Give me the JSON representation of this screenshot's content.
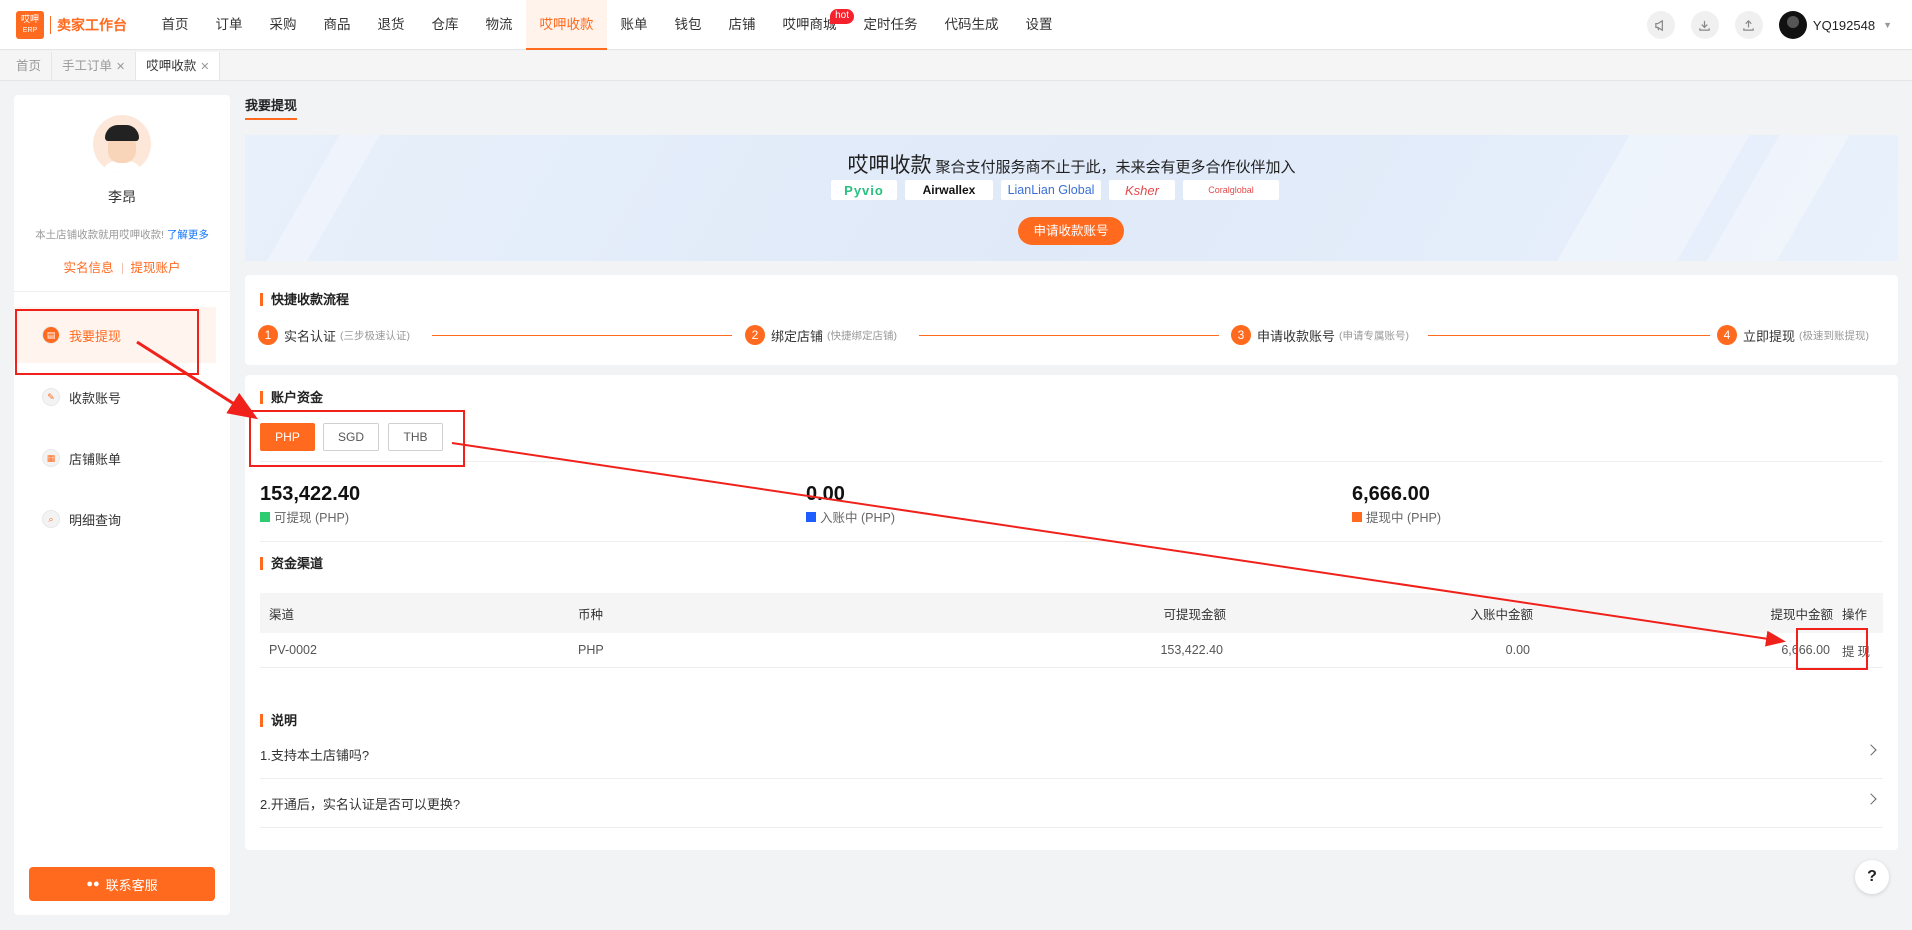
{
  "app": {
    "logo_small": "哎呷",
    "logo_tag": "ERP",
    "logo_text": "卖家工作台"
  },
  "nav": {
    "items": [
      "首页",
      "订单",
      "采购",
      "商品",
      "退货",
      "仓库",
      "物流",
      "哎呷收款",
      "账单",
      "钱包",
      "店铺",
      "哎呷商城",
      "定时任务",
      "代码生成",
      "设置"
    ],
    "active_index": 7,
    "hot_badge": "hot",
    "user": "YQ192548"
  },
  "tabs": [
    {
      "label": "首页",
      "closable": false
    },
    {
      "label": "手工订单",
      "closable": true
    },
    {
      "label": "哎呷收款",
      "closable": true
    }
  ],
  "profile": {
    "name": "李昂",
    "desc": "本土店铺收款就用哎呷收款!",
    "learn_more": "了解更多",
    "link_realname": "实名信息",
    "link_account": "提现账户"
  },
  "menu": [
    {
      "label": "我要提现",
      "active": true
    },
    {
      "label": "收款账号",
      "active": false
    },
    {
      "label": "店铺账单",
      "active": false
    },
    {
      "label": "明细查询",
      "active": false
    }
  ],
  "contact_label": "联系客服",
  "page_tab": "我要提现",
  "banner": {
    "title_big": "哎呷收款",
    "title_small": "聚合支付服务商不止于此，未来会有更多合作伙伴加入",
    "partners": [
      "Pyvio",
      "Airwallex",
      "LianLian Global",
      "Ksher",
      "Coralglobal"
    ],
    "apply_label": "申请收款账号"
  },
  "flow": {
    "title": "快捷收款流程",
    "steps": [
      {
        "num": "1",
        "label": "实名认证",
        "sub": "(三步极速认证)"
      },
      {
        "num": "2",
        "label": "绑定店铺",
        "sub": "(快捷绑定店铺)"
      },
      {
        "num": "3",
        "label": "申请收款账号",
        "sub": "(申请专属账号)"
      },
      {
        "num": "4",
        "label": "立即提现",
        "sub": "(极速到账提现)"
      }
    ]
  },
  "funds": {
    "title": "账户资金",
    "currencies": [
      "PHP",
      "SGD",
      "THB"
    ],
    "active_currency": "PHP",
    "balances": [
      {
        "value": "153,422.40",
        "label": "可提现 (PHP)",
        "color": "#2ecc71"
      },
      {
        "value": "0.00",
        "label": "入账中 (PHP)",
        "color": "#1e5eff"
      },
      {
        "value": "6,666.00",
        "label": "提现中 (PHP)",
        "color": "#ff6a1f"
      }
    ]
  },
  "channels": {
    "title": "资金渠道",
    "columns": [
      "渠道",
      "币种",
      "可提现金额",
      "入账中金额",
      "提现中金额",
      "操作"
    ],
    "rows": [
      {
        "channel": "PV-0002",
        "currency": "PHP",
        "available": "153,422.40",
        "pending": "0.00",
        "withdrawing": "6,666.00",
        "action": "提现"
      }
    ]
  },
  "notes": {
    "title": "说明",
    "items": [
      "1.支持本土店铺吗?",
      "2.开通后，实名认证是否可以更换?"
    ]
  },
  "help_label": "?",
  "colors": {
    "accent": "#ff6a1f",
    "annotation": "#f0201a",
    "link": "#1677ff"
  }
}
